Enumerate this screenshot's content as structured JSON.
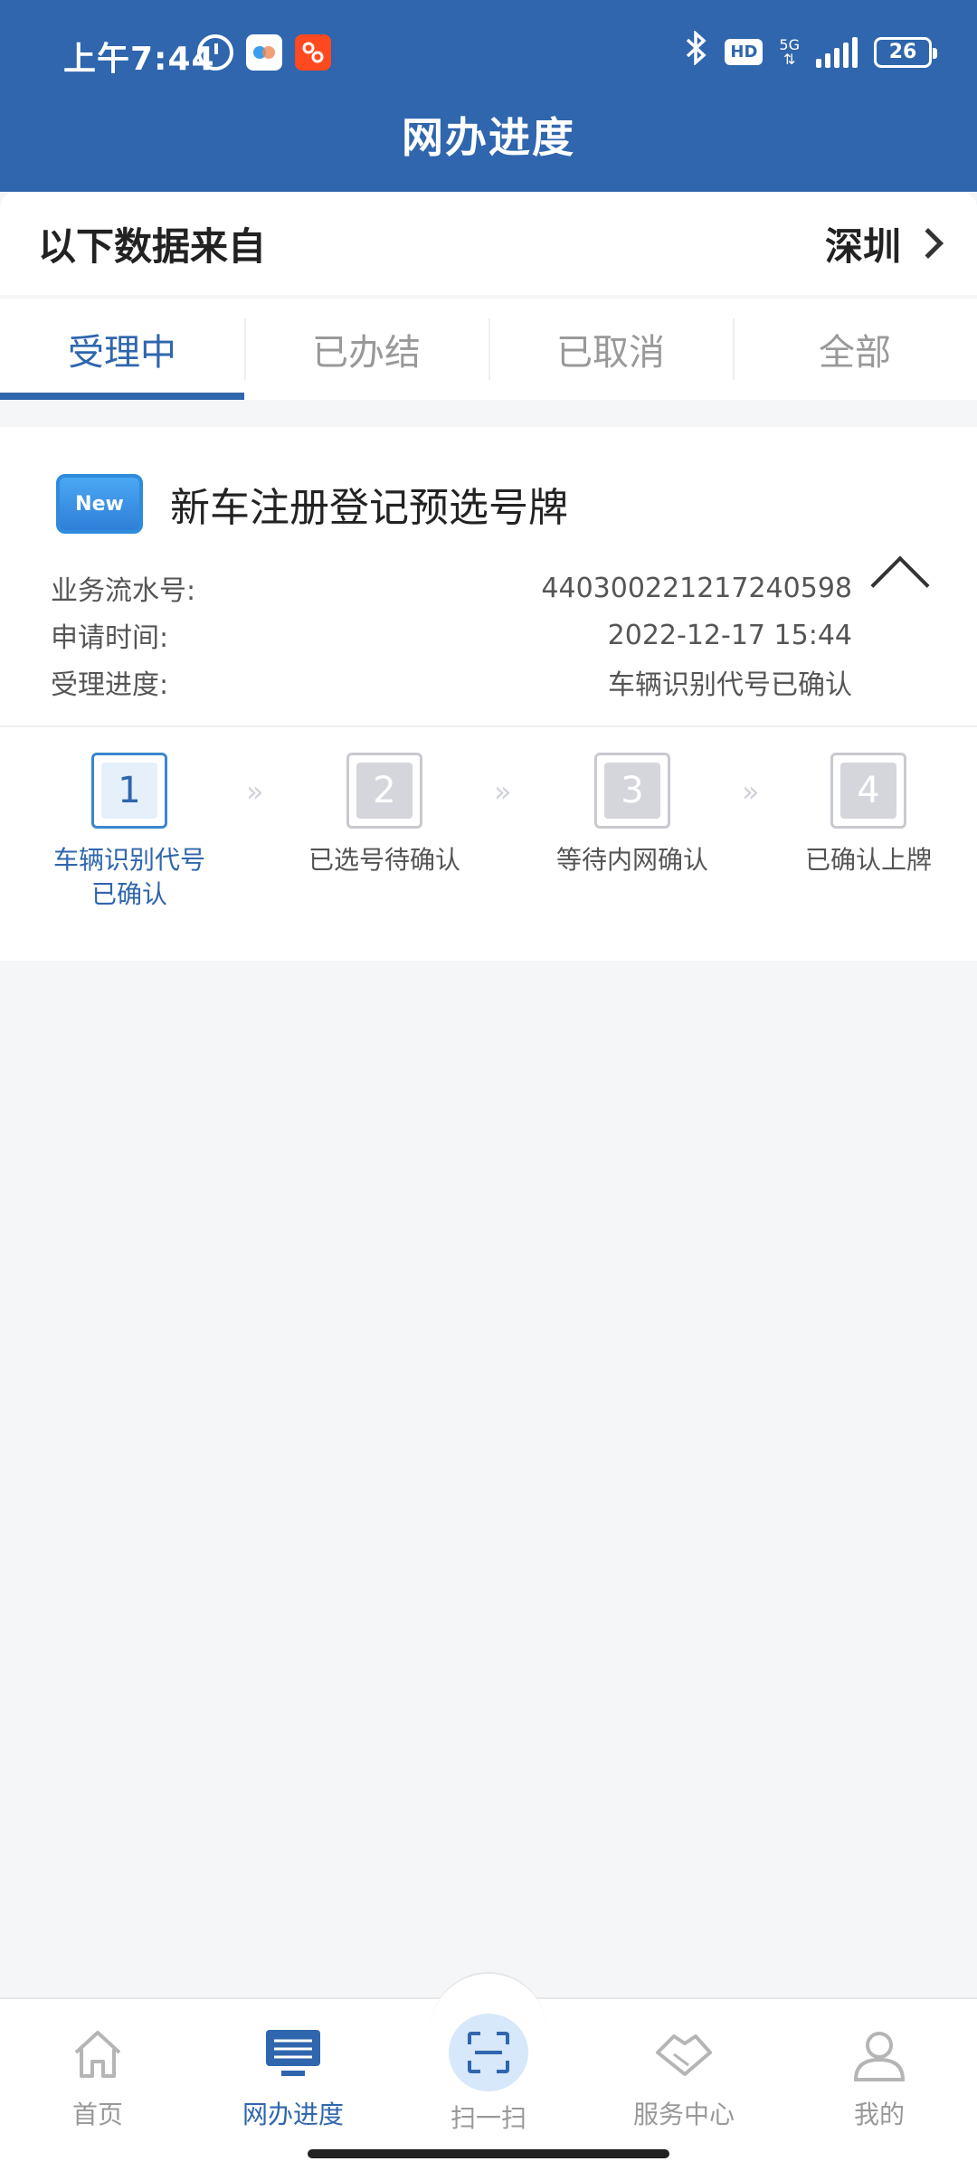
{
  "status_bar": {
    "time": "上午7:44",
    "network": "5G",
    "hd": "HD",
    "battery": "26"
  },
  "header": {
    "title": "网办进度"
  },
  "source": {
    "label": "以下数据来自",
    "city": "深圳"
  },
  "tabs": [
    {
      "label": "受理中",
      "active": true
    },
    {
      "label": "已办结",
      "active": false
    },
    {
      "label": "已取消",
      "active": false
    },
    {
      "label": "全部",
      "active": false
    }
  ],
  "card": {
    "badge": "New",
    "title": "新车注册登记预选号牌",
    "rows": [
      {
        "label": "业务流水号:",
        "value": "440300221217240598"
      },
      {
        "label": "申请时间:",
        "value": "2022-12-17 15:44"
      },
      {
        "label": "受理进度:",
        "value": "车辆识别代号已确认"
      }
    ],
    "steps": [
      {
        "num": "1",
        "label1": "车辆识别代号",
        "label2": "已确认",
        "active": true
      },
      {
        "num": "2",
        "label1": "已选号待确认",
        "label2": "",
        "active": false
      },
      {
        "num": "3",
        "label1": "等待内网确认",
        "label2": "",
        "active": false
      },
      {
        "num": "4",
        "label1": "已确认上牌",
        "label2": "",
        "active": false
      }
    ],
    "step_separator": "»"
  },
  "bottom_nav": [
    {
      "label": "首页",
      "icon": "home-icon",
      "active": false
    },
    {
      "label": "网办进度",
      "icon": "monitor-icon",
      "active": true
    },
    {
      "label": "扫一扫",
      "icon": "scan-icon",
      "active": false
    },
    {
      "label": "服务中心",
      "icon": "handshake-icon",
      "active": false
    },
    {
      "label": "我的",
      "icon": "user-icon",
      "active": false
    }
  ],
  "colors": {
    "brand": "#2f66ad",
    "inactive": "#999999"
  }
}
